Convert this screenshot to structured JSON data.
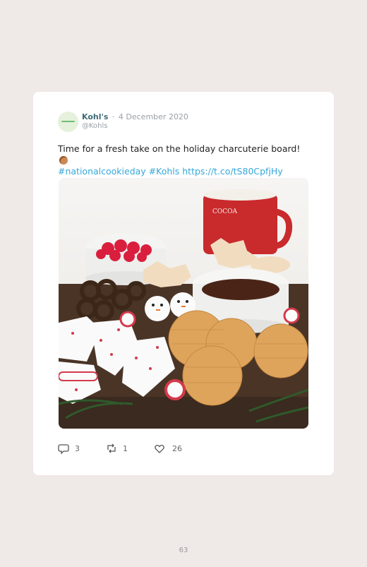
{
  "tweet": {
    "author_name": "Kohl's",
    "separator": "·",
    "date": "4 December 2020",
    "handle": "@Kohls",
    "text_line1": "Time for a fresh take on the holiday charcuterie board!",
    "text_emoji": "cookie-emoji",
    "text_line2": "#nationalcookieday #Kohls https://t.co/tS80CpfjHy",
    "image_alt": "holiday charcuterie board photo",
    "actions": {
      "reply_count": "3",
      "retweet_count": "1",
      "like_count": "26"
    }
  },
  "page": {
    "number": "63"
  },
  "icons": {
    "reply": "reply-icon",
    "retweet": "retweet-icon",
    "like": "heart-icon"
  },
  "colors": {
    "background": "#efe9e7",
    "card": "#ffffff",
    "name": "#3e6b76",
    "link": "#36a7d8"
  }
}
